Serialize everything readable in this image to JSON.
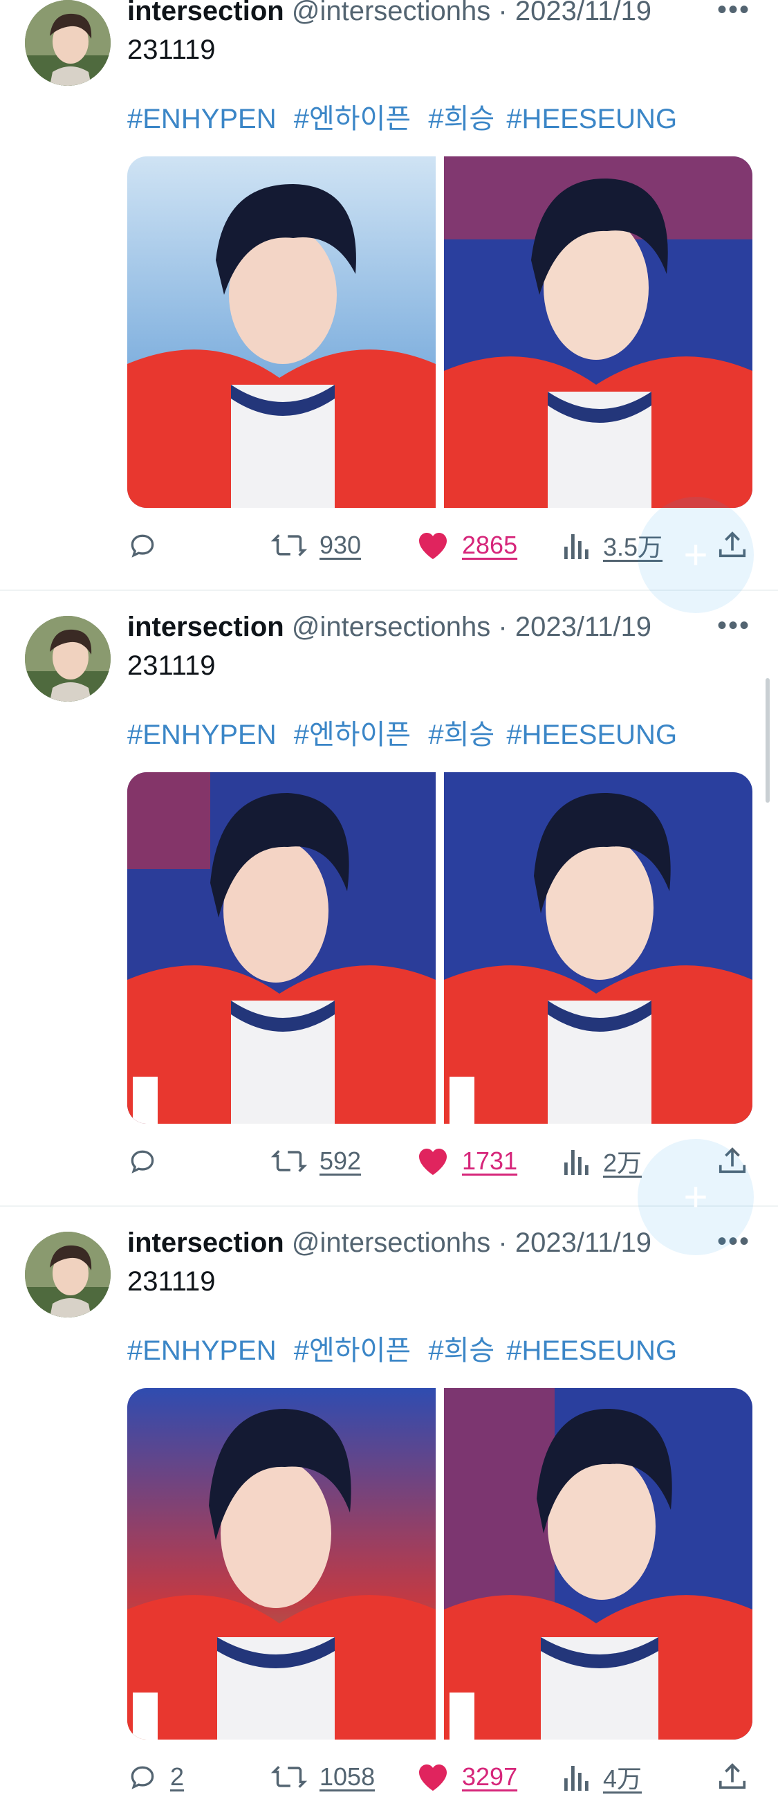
{
  "tweets": [
    {
      "author": "intersection",
      "handle": "@intersectionhs",
      "separator": "·",
      "date": "2023/11/19",
      "text": "231119",
      "hashtags": [
        "#ENHYPEN",
        "#엔하이픈",
        "#희승",
        "#HEESEUNG"
      ],
      "reply_count": "",
      "retweet_count": "930",
      "like_count": "2865",
      "view_count": "3.5万"
    },
    {
      "author": "intersection",
      "handle": "@intersectionhs",
      "separator": "·",
      "date": "2023/11/19",
      "text": "231119",
      "hashtags": [
        "#ENHYPEN",
        "#엔하이픈",
        "#희승",
        "#HEESEUNG"
      ],
      "reply_count": "",
      "retweet_count": "592",
      "like_count": "1731",
      "view_count": "2万"
    },
    {
      "author": "intersection",
      "handle": "@intersectionhs",
      "separator": "·",
      "date": "2023/11/19",
      "text": "231119",
      "hashtags": [
        "#ENHYPEN",
        "#엔하이픈",
        "#희승",
        "#HEESEUNG"
      ],
      "reply_count": "2",
      "retweet_count": "1058",
      "like_count": "3297",
      "view_count": "4万"
    }
  ],
  "icons": {
    "more": "ellipsis-icon",
    "reply": "reply-icon",
    "retweet": "retweet-icon",
    "like": "heart-icon",
    "views": "views-icon",
    "share": "share-icon",
    "fab": "plus-icon"
  },
  "colors": {
    "hashtag": "#3b86c7",
    "like": "#e0245e",
    "muted": "#536471",
    "jacket": "#e8372f"
  }
}
